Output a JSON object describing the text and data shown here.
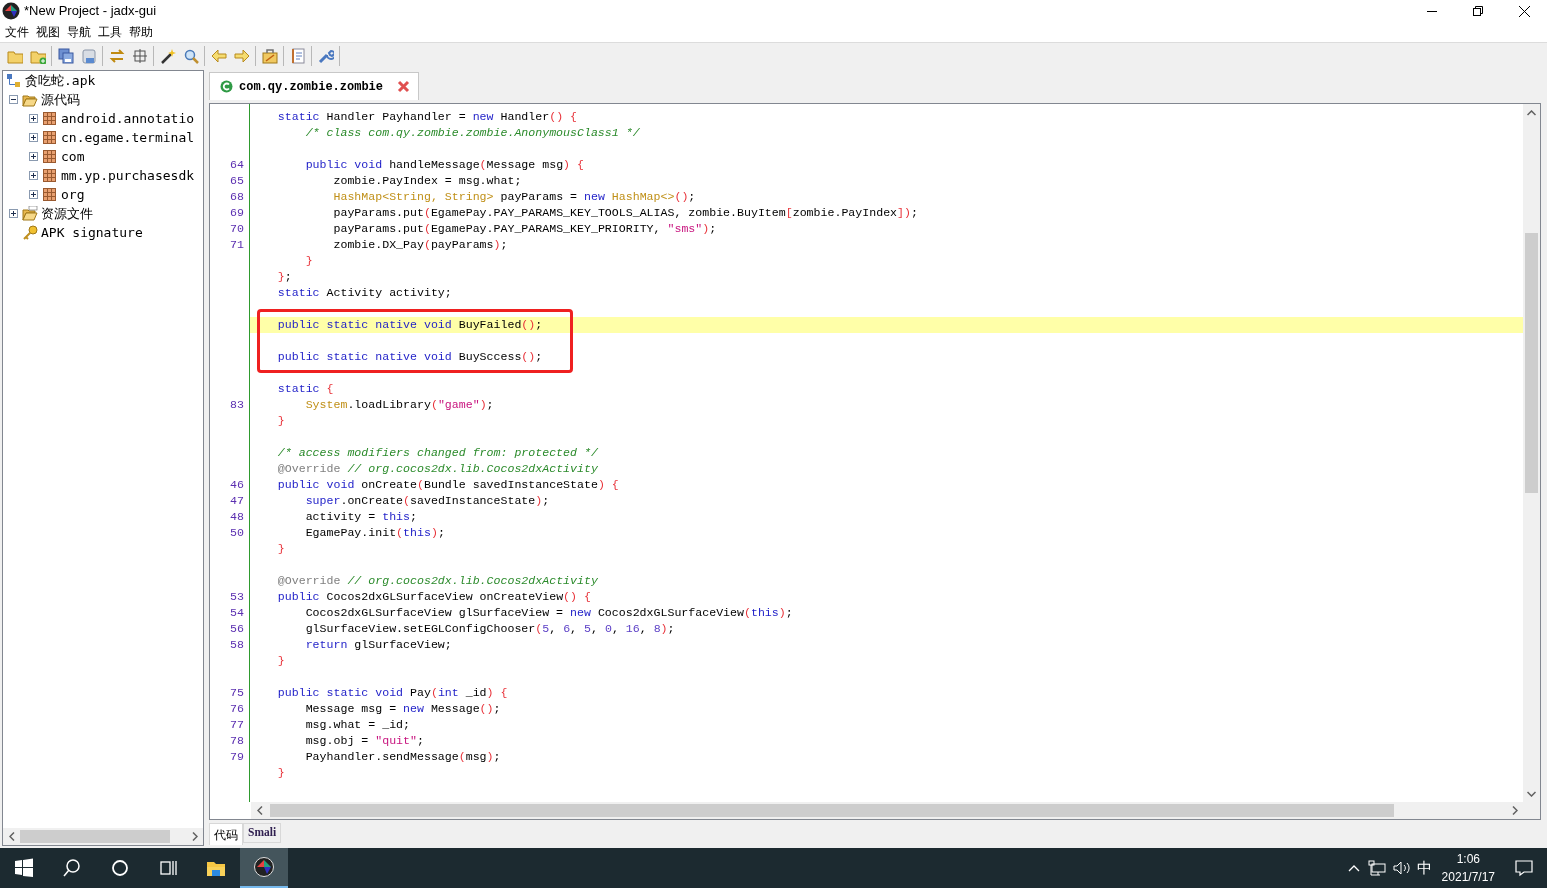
{
  "window": {
    "title": "*New Project - jadx-gui"
  },
  "menu": [
    "文件",
    "视图",
    "导航",
    "工具",
    "帮助"
  ],
  "tree": {
    "label": "贪吃蛇.apk",
    "kind": "apk",
    "children": [
      {
        "label": "源代码",
        "kind": "source-folder",
        "expanded": true,
        "children": [
          {
            "label": "android.annotatio",
            "kind": "package",
            "expanded": false
          },
          {
            "label": "cn.egame.terminal",
            "kind": "package",
            "expanded": false
          },
          {
            "label": "com",
            "kind": "package",
            "expanded": false
          },
          {
            "label": "mm.yp.purchasesdk",
            "kind": "package",
            "expanded": false
          },
          {
            "label": "org",
            "kind": "package",
            "expanded": false
          }
        ]
      },
      {
        "label": "资源文件",
        "kind": "resource-folder",
        "expanded": false
      },
      {
        "label": "APK signature",
        "kind": "signature"
      }
    ]
  },
  "editor_tabs": [
    {
      "label": "com.qy.zombie.zombie",
      "selected": true
    }
  ],
  "editor": {
    "lines": [
      {
        "highlighted": false,
        "boxed": false,
        "tokens": [
          {
            "kind": "keyword",
            "text": "    static"
          },
          {
            "kind": "plain",
            "text": " Handler Payhandler = "
          },
          {
            "kind": "keyword",
            "text": "new"
          },
          {
            "kind": "plain",
            "text": " Handler"
          },
          {
            "kind": "bracket",
            "text": "() {"
          }
        ]
      },
      {
        "highlighted": false,
        "boxed": false,
        "tokens": [
          {
            "kind": "comment",
            "text": "        /* class com.qy.zombie.zombie.AnonymousClass1 */"
          }
        ]
      },
      {
        "highlighted": false,
        "boxed": false
      },
      {
        "number": "64",
        "highlighted": false,
        "boxed": false,
        "tokens": [
          {
            "kind": "keyword",
            "text": "        public void"
          },
          {
            "kind": "plain",
            "text": " handleMessage"
          },
          {
            "kind": "bracket",
            "text": "("
          },
          {
            "kind": "plain",
            "text": "Message msg"
          },
          {
            "kind": "bracket",
            "text": ") {"
          }
        ]
      },
      {
        "number": "65",
        "highlighted": false,
        "boxed": false,
        "tokens": [
          {
            "kind": "plain",
            "text": "            zombie.PayIndex = msg.what;"
          }
        ]
      },
      {
        "number": "68",
        "highlighted": false,
        "boxed": false,
        "tokens": [
          {
            "kind": "type",
            "text": "            HashMap<String, String>"
          },
          {
            "kind": "plain",
            "text": " payParams = "
          },
          {
            "kind": "keyword",
            "text": "new"
          },
          {
            "kind": "type",
            "text": " HashMap<>"
          },
          {
            "kind": "bracket",
            "text": "()"
          },
          {
            "kind": "plain",
            "text": ";"
          }
        ]
      },
      {
        "number": "69",
        "highlighted": false,
        "boxed": false,
        "tokens": [
          {
            "kind": "plain",
            "text": "            payParams.put"
          },
          {
            "kind": "bracket",
            "text": "("
          },
          {
            "kind": "plain",
            "text": "EgamePay.PAY_PARAMS_KEY_TOOLS_ALIAS, zombie.BuyItem"
          },
          {
            "kind": "bracket",
            "text": "["
          },
          {
            "kind": "plain",
            "text": "zombie.PayIndex"
          },
          {
            "kind": "bracket",
            "text": "])"
          },
          {
            "kind": "plain",
            "text": ";"
          }
        ]
      },
      {
        "number": "70",
        "highlighted": false,
        "boxed": false,
        "tokens": [
          {
            "kind": "plain",
            "text": "            payParams.put"
          },
          {
            "kind": "bracket",
            "text": "("
          },
          {
            "kind": "plain",
            "text": "EgamePay.PAY_PARAMS_KEY_PRIORITY, "
          },
          {
            "kind": "string",
            "text": "\"sms\""
          },
          {
            "kind": "bracket",
            "text": ")"
          },
          {
            "kind": "plain",
            "text": ";"
          }
        ]
      },
      {
        "number": "71",
        "highlighted": false,
        "boxed": false,
        "tokens": [
          {
            "kind": "plain",
            "text": "            zombie.DX_Pay"
          },
          {
            "kind": "bracket",
            "text": "("
          },
          {
            "kind": "plain",
            "text": "payParams"
          },
          {
            "kind": "bracket",
            "text": ")"
          },
          {
            "kind": "plain",
            "text": ";"
          }
        ]
      },
      {
        "highlighted": false,
        "boxed": false,
        "tokens": [
          {
            "kind": "bracket",
            "text": "        }"
          }
        ]
      },
      {
        "highlighted": false,
        "boxed": false,
        "tokens": [
          {
            "kind": "bracket",
            "text": "    }"
          },
          {
            "kind": "plain",
            "text": ";"
          }
        ]
      },
      {
        "highlighted": false,
        "boxed": false,
        "tokens": [
          {
            "kind": "keyword",
            "text": "    static"
          },
          {
            "kind": "plain",
            "text": " Activity activity;"
          }
        ]
      },
      {
        "highlighted": false,
        "boxed": false
      },
      {
        "highlighted": true,
        "boxed": true,
        "tokens": [
          {
            "kind": "keyword",
            "text": "    public static native void"
          },
          {
            "kind": "plain",
            "text": " BuyFailed"
          },
          {
            "kind": "bracket",
            "text": "()"
          },
          {
            "kind": "plain",
            "text": ";"
          }
        ]
      },
      {
        "highlighted": false,
        "boxed": true
      },
      {
        "highlighted": false,
        "boxed": true,
        "tokens": [
          {
            "kind": "keyword",
            "text": "    public static native void"
          },
          {
            "kind": "plain",
            "text": " BuySccess"
          },
          {
            "kind": "bracket",
            "text": "()"
          },
          {
            "kind": "plain",
            "text": ";"
          }
        ]
      },
      {
        "highlighted": false,
        "boxed": false
      },
      {
        "highlighted": false,
        "boxed": false,
        "tokens": [
          {
            "kind": "keyword",
            "text": "    static"
          },
          {
            "kind": "bracket",
            "text": " {"
          }
        ]
      },
      {
        "number": "83",
        "highlighted": false,
        "boxed": false,
        "tokens": [
          {
            "kind": "type",
            "text": "        System"
          },
          {
            "kind": "plain",
            "text": ".loadLibrary"
          },
          {
            "kind": "bracket",
            "text": "("
          },
          {
            "kind": "string",
            "text": "\"game\""
          },
          {
            "kind": "bracket",
            "text": ")"
          },
          {
            "kind": "plain",
            "text": ";"
          }
        ]
      },
      {
        "highlighted": false,
        "boxed": false,
        "tokens": [
          {
            "kind": "bracket",
            "text": "    }"
          }
        ]
      },
      {
        "highlighted": false,
        "boxed": false
      },
      {
        "highlighted": false,
        "boxed": false,
        "tokens": [
          {
            "kind": "comment",
            "text": "    /* access modifiers changed from: protected */"
          }
        ]
      },
      {
        "highlighted": false,
        "boxed": false,
        "tokens": [
          {
            "kind": "annotation",
            "text": "    @Override"
          },
          {
            "kind": "comment",
            "text": " // org.cocos2dx.lib.Cocos2dxActivity"
          }
        ]
      },
      {
        "number": "46",
        "highlighted": false,
        "boxed": false,
        "tokens": [
          {
            "kind": "keyword",
            "text": "    public void"
          },
          {
            "kind": "plain",
            "text": " onCreate"
          },
          {
            "kind": "bracket",
            "text": "("
          },
          {
            "kind": "plain",
            "text": "Bundle savedInstanceState"
          },
          {
            "kind": "bracket",
            "text": ") {"
          }
        ]
      },
      {
        "number": "47",
        "highlighted": false,
        "boxed": false,
        "tokens": [
          {
            "kind": "keyword",
            "text": "        super"
          },
          {
            "kind": "plain",
            "text": ".onCreate"
          },
          {
            "kind": "bracket",
            "text": "("
          },
          {
            "kind": "plain",
            "text": "savedInstanceState"
          },
          {
            "kind": "bracket",
            "text": ")"
          },
          {
            "kind": "plain",
            "text": ";"
          }
        ]
      },
      {
        "number": "48",
        "highlighted": false,
        "boxed": false,
        "tokens": [
          {
            "kind": "plain",
            "text": "        activity = "
          },
          {
            "kind": "keyword",
            "text": "this"
          },
          {
            "kind": "plain",
            "text": ";"
          }
        ]
      },
      {
        "number": "50",
        "highlighted": false,
        "boxed": false,
        "tokens": [
          {
            "kind": "plain",
            "text": "        EgamePay.init"
          },
          {
            "kind": "bracket",
            "text": "("
          },
          {
            "kind": "keyword",
            "text": "this"
          },
          {
            "kind": "bracket",
            "text": ")"
          },
          {
            "kind": "plain",
            "text": ";"
          }
        ]
      },
      {
        "highlighted": false,
        "boxed": false,
        "tokens": [
          {
            "kind": "bracket",
            "text": "    }"
          }
        ]
      },
      {
        "highlighted": false,
        "boxed": false
      },
      {
        "highlighted": false,
        "boxed": false,
        "tokens": [
          {
            "kind": "annotation",
            "text": "    @Override"
          },
          {
            "kind": "comment",
            "text": " // org.cocos2dx.lib.Cocos2dxActivity"
          }
        ]
      },
      {
        "number": "53",
        "highlighted": false,
        "boxed": false,
        "tokens": [
          {
            "kind": "keyword",
            "text": "    public"
          },
          {
            "kind": "plain",
            "text": " Cocos2dxGLSurfaceView onCreateView"
          },
          {
            "kind": "bracket",
            "text": "() {"
          }
        ]
      },
      {
        "number": "54",
        "highlighted": false,
        "boxed": false,
        "tokens": [
          {
            "kind": "plain",
            "text": "        Cocos2dxGLSurfaceView glSurfaceView = "
          },
          {
            "kind": "keyword",
            "text": "new"
          },
          {
            "kind": "plain",
            "text": " Cocos2dxGLSurfaceView"
          },
          {
            "kind": "bracket",
            "text": "("
          },
          {
            "kind": "keyword",
            "text": "this"
          },
          {
            "kind": "bracket",
            "text": ")"
          },
          {
            "kind": "plain",
            "text": ";"
          }
        ]
      },
      {
        "number": "56",
        "highlighted": false,
        "boxed": false,
        "tokens": [
          {
            "kind": "plain",
            "text": "        glSurfaceView.setEGLConfigChooser"
          },
          {
            "kind": "bracket",
            "text": "("
          },
          {
            "kind": "number",
            "text": "5"
          },
          {
            "kind": "plain",
            "text": ", "
          },
          {
            "kind": "number",
            "text": "6"
          },
          {
            "kind": "plain",
            "text": ", "
          },
          {
            "kind": "number",
            "text": "5"
          },
          {
            "kind": "plain",
            "text": ", "
          },
          {
            "kind": "number",
            "text": "0"
          },
          {
            "kind": "plain",
            "text": ", "
          },
          {
            "kind": "number",
            "text": "16"
          },
          {
            "kind": "plain",
            "text": ", "
          },
          {
            "kind": "number",
            "text": "8"
          },
          {
            "kind": "bracket",
            "text": ")"
          },
          {
            "kind": "plain",
            "text": ";"
          }
        ]
      },
      {
        "number": "58",
        "highlighted": false,
        "boxed": false,
        "tokens": [
          {
            "kind": "keyword",
            "text": "        return"
          },
          {
            "kind": "plain",
            "text": " glSurfaceView;"
          }
        ]
      },
      {
        "highlighted": false,
        "boxed": false,
        "tokens": [
          {
            "kind": "bracket",
            "text": "    }"
          }
        ]
      },
      {
        "highlighted": false,
        "boxed": false
      },
      {
        "number": "75",
        "highlighted": false,
        "boxed": false,
        "tokens": [
          {
            "kind": "keyword",
            "text": "    public static void"
          },
          {
            "kind": "plain",
            "text": " Pay"
          },
          {
            "kind": "bracket",
            "text": "("
          },
          {
            "kind": "keyword",
            "text": "int"
          },
          {
            "kind": "plain",
            "text": " _id"
          },
          {
            "kind": "bracket",
            "text": ") {"
          }
        ]
      },
      {
        "number": "76",
        "highlighted": false,
        "boxed": false,
        "tokens": [
          {
            "kind": "plain",
            "text": "        Message msg = "
          },
          {
            "kind": "keyword",
            "text": "new"
          },
          {
            "kind": "plain",
            "text": " Message"
          },
          {
            "kind": "bracket",
            "text": "()"
          },
          {
            "kind": "plain",
            "text": ";"
          }
        ]
      },
      {
        "number": "77",
        "highlighted": false,
        "boxed": false,
        "tokens": [
          {
            "kind": "plain",
            "text": "        msg.what = _id;"
          }
        ]
      },
      {
        "number": "78",
        "highlighted": false,
        "boxed": false,
        "tokens": [
          {
            "kind": "plain",
            "text": "        msg.obj = "
          },
          {
            "kind": "string",
            "text": "\"quit\""
          },
          {
            "kind": "plain",
            "text": ";"
          }
        ]
      },
      {
        "number": "79",
        "highlighted": false,
        "boxed": false,
        "tokens": [
          {
            "kind": "plain",
            "text": "        Payhandler.sendMessage"
          },
          {
            "kind": "bracket",
            "text": "("
          },
          {
            "kind": "plain",
            "text": "msg"
          },
          {
            "kind": "bracket",
            "text": ")"
          },
          {
            "kind": "plain",
            "text": ";"
          }
        ]
      },
      {
        "highlighted": false,
        "boxed": false,
        "tokens": [
          {
            "kind": "bracket",
            "text": "    }"
          }
        ]
      }
    ]
  },
  "view_tabs": [
    {
      "label": "代码",
      "selected": true
    },
    {
      "label": "Smali",
      "selected": false
    }
  ],
  "taskbar": {
    "apps": [
      {
        "kind": "file-explorer",
        "selected": false
      },
      {
        "kind": "jadx",
        "selected": true
      }
    ],
    "ime": "中",
    "time": "1:06",
    "date": "2021/7/17"
  }
}
